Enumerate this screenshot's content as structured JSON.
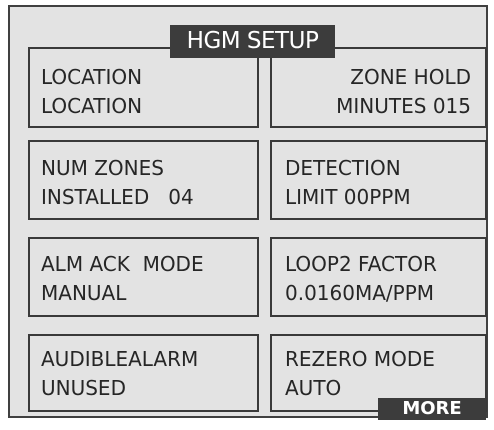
{
  "screen": {
    "title": "HGM SETUP",
    "more_label": "MORE"
  },
  "fields": [
    {
      "line1": "LOCATION",
      "line2": "LOCATION"
    },
    {
      "line1": "ZONE HOLD",
      "line2": "MINUTES 015"
    },
    {
      "line1": "NUM ZONES",
      "line2": "INSTALLED   04"
    },
    {
      "line1": "DETECTION",
      "line2": "LIMIT 00PPM"
    },
    {
      "line1": "ALM ACK  MODE",
      "line2": "MANUAL"
    },
    {
      "line1": "LOOP2 FACTOR",
      "line2": "0.0160MA/PPM"
    },
    {
      "line1": "AUDIBLEALARM",
      "line2": "UNUSED"
    },
    {
      "line1": "REZERO MODE",
      "line2": "AUTO"
    }
  ],
  "colors": {
    "background": "#e3e3e3",
    "title_bar": "#3c3c3c",
    "border": "#3a3a3a",
    "text": "#262626"
  }
}
